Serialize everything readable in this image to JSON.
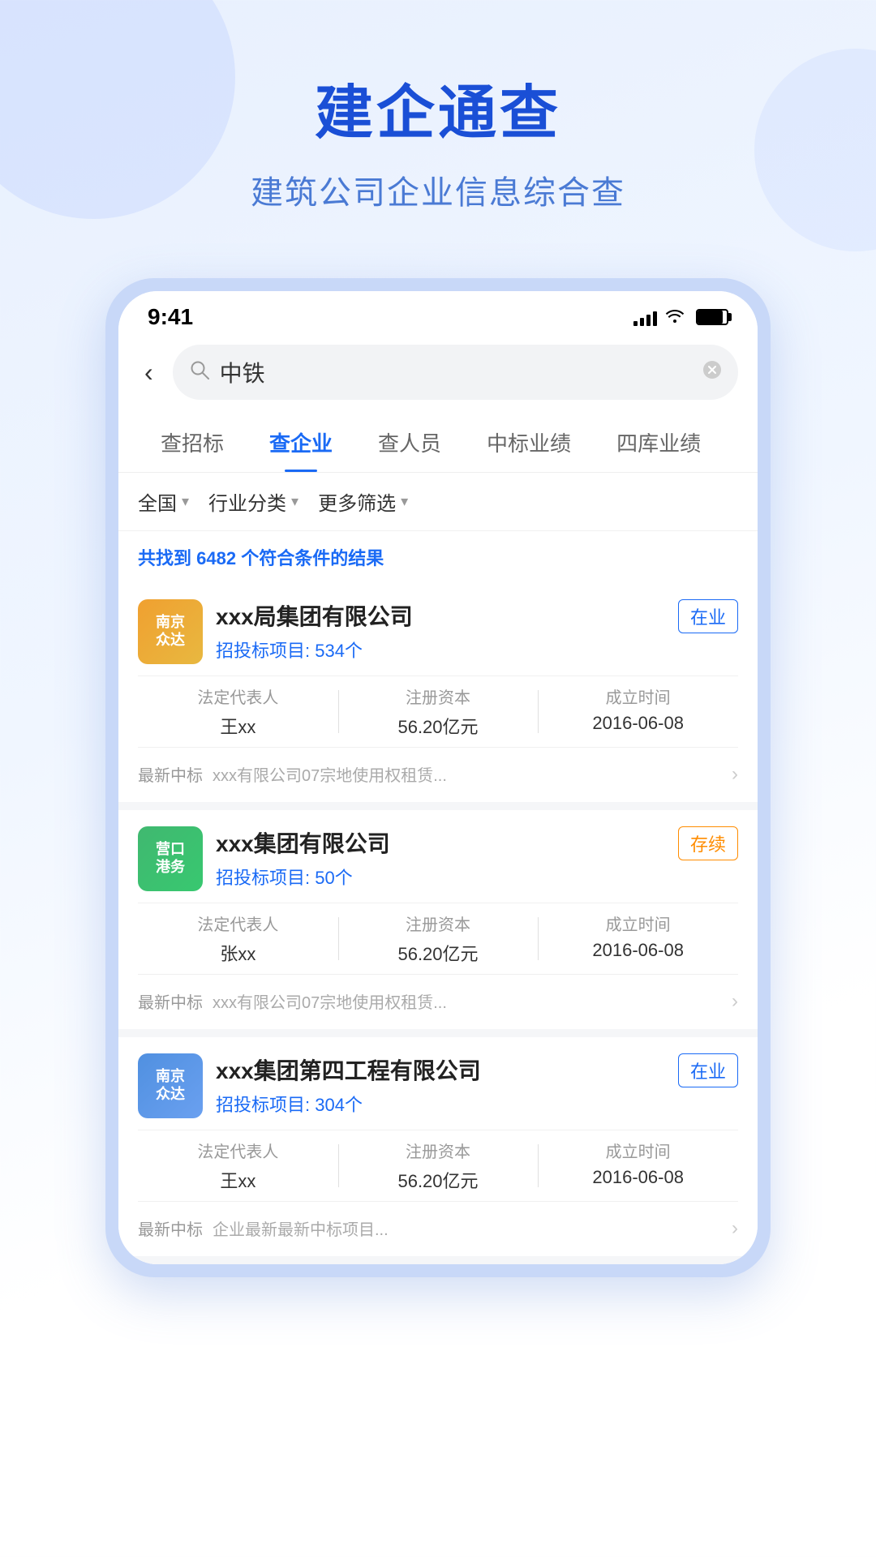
{
  "header": {
    "title": "建企通查",
    "subtitle": "建筑公司企业信息综合查"
  },
  "phone": {
    "statusBar": {
      "time": "9:41",
      "signal": [
        4,
        8,
        12,
        16,
        20
      ],
      "wifi": "▲",
      "battery": "■"
    },
    "searchBar": {
      "backLabel": "‹",
      "placeholder": "中铁",
      "clearIcon": "✕"
    },
    "tabs": [
      {
        "label": "查招标",
        "active": false
      },
      {
        "label": "查企业",
        "active": true
      },
      {
        "label": "查人员",
        "active": false
      },
      {
        "label": "中标业绩",
        "active": false
      },
      {
        "label": "四库业绩",
        "active": false
      }
    ],
    "filters": [
      {
        "label": "全国",
        "hasArrow": true
      },
      {
        "label": "行业分类",
        "hasArrow": true
      },
      {
        "label": "更多筛选",
        "hasArrow": true
      }
    ],
    "resultCount": {
      "prefix": "共找到 ",
      "count": "6482",
      "suffix": " 个符合条件的结果"
    },
    "companies": [
      {
        "logo": {
          "line1": "南京",
          "line2": "众达",
          "colorClass": "logo-nanjing"
        },
        "name": "xxx局集团有限公司",
        "projectCount": "534个",
        "projectLabel": "招投标项目: ",
        "status": "在业",
        "statusClass": "active-badge",
        "details": [
          {
            "label": "法定代表人",
            "value": "王xx"
          },
          {
            "label": "注册资本",
            "value": "56.20亿元"
          },
          {
            "label": "成立时间",
            "value": "2016-06-08"
          }
        ],
        "latestBid": {
          "label": "最新中标",
          "text": "xxx有限公司07宗地使用权租赁..."
        }
      },
      {
        "logo": {
          "line1": "营口",
          "line2": "港务",
          "colorClass": "logo-yingkou"
        },
        "name": "xxx集团有限公司",
        "projectCount": "50个",
        "projectLabel": "招投标项目: ",
        "status": "存续",
        "statusClass": "continue-badge",
        "details": [
          {
            "label": "法定代表人",
            "value": "张xx"
          },
          {
            "label": "注册资本",
            "value": "56.20亿元"
          },
          {
            "label": "成立时间",
            "value": "2016-06-08"
          }
        ],
        "latestBid": {
          "label": "最新中标",
          "text": "xxx有限公司07宗地使用权租赁..."
        }
      },
      {
        "logo": {
          "line1": "南京",
          "line2": "众达",
          "colorClass": "logo-nanjing2"
        },
        "name": "xxx集团第四工程有限公司",
        "projectCount": "304个",
        "projectLabel": "招投标项目: ",
        "status": "在业",
        "statusClass": "active-badge",
        "details": [
          {
            "label": "法定代表人",
            "value": "王xx"
          },
          {
            "label": "注册资本",
            "value": "56.20亿元"
          },
          {
            "label": "成立时间",
            "value": "2016-06-08"
          }
        ],
        "latestBid": {
          "label": "最新中标",
          "text": "企业最新最新中标项目..."
        }
      }
    ]
  }
}
